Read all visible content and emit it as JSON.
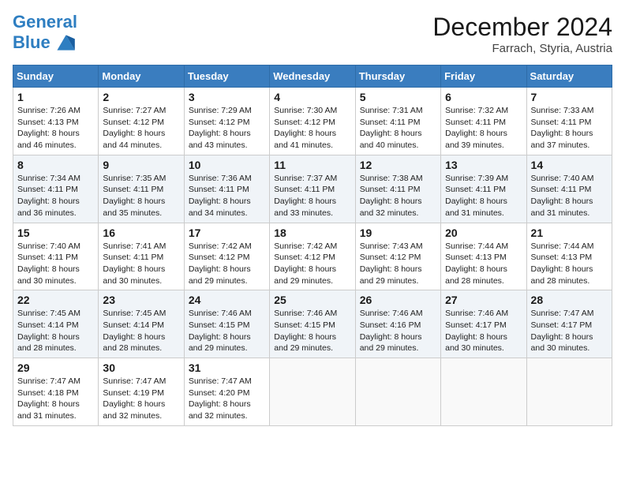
{
  "header": {
    "logo_line1": "General",
    "logo_line2": "Blue",
    "month_title": "December 2024",
    "location": "Farrach, Styria, Austria"
  },
  "columns": [
    "Sunday",
    "Monday",
    "Tuesday",
    "Wednesday",
    "Thursday",
    "Friday",
    "Saturday"
  ],
  "weeks": [
    [
      {
        "day": "1",
        "sunrise": "Sunrise: 7:26 AM",
        "sunset": "Sunset: 4:13 PM",
        "daylight": "Daylight: 8 hours and 46 minutes."
      },
      {
        "day": "2",
        "sunrise": "Sunrise: 7:27 AM",
        "sunset": "Sunset: 4:12 PM",
        "daylight": "Daylight: 8 hours and 44 minutes."
      },
      {
        "day": "3",
        "sunrise": "Sunrise: 7:29 AM",
        "sunset": "Sunset: 4:12 PM",
        "daylight": "Daylight: 8 hours and 43 minutes."
      },
      {
        "day": "4",
        "sunrise": "Sunrise: 7:30 AM",
        "sunset": "Sunset: 4:12 PM",
        "daylight": "Daylight: 8 hours and 41 minutes."
      },
      {
        "day": "5",
        "sunrise": "Sunrise: 7:31 AM",
        "sunset": "Sunset: 4:11 PM",
        "daylight": "Daylight: 8 hours and 40 minutes."
      },
      {
        "day": "6",
        "sunrise": "Sunrise: 7:32 AM",
        "sunset": "Sunset: 4:11 PM",
        "daylight": "Daylight: 8 hours and 39 minutes."
      },
      {
        "day": "7",
        "sunrise": "Sunrise: 7:33 AM",
        "sunset": "Sunset: 4:11 PM",
        "daylight": "Daylight: 8 hours and 37 minutes."
      }
    ],
    [
      {
        "day": "8",
        "sunrise": "Sunrise: 7:34 AM",
        "sunset": "Sunset: 4:11 PM",
        "daylight": "Daylight: 8 hours and 36 minutes."
      },
      {
        "day": "9",
        "sunrise": "Sunrise: 7:35 AM",
        "sunset": "Sunset: 4:11 PM",
        "daylight": "Daylight: 8 hours and 35 minutes."
      },
      {
        "day": "10",
        "sunrise": "Sunrise: 7:36 AM",
        "sunset": "Sunset: 4:11 PM",
        "daylight": "Daylight: 8 hours and 34 minutes."
      },
      {
        "day": "11",
        "sunrise": "Sunrise: 7:37 AM",
        "sunset": "Sunset: 4:11 PM",
        "daylight": "Daylight: 8 hours and 33 minutes."
      },
      {
        "day": "12",
        "sunrise": "Sunrise: 7:38 AM",
        "sunset": "Sunset: 4:11 PM",
        "daylight": "Daylight: 8 hours and 32 minutes."
      },
      {
        "day": "13",
        "sunrise": "Sunrise: 7:39 AM",
        "sunset": "Sunset: 4:11 PM",
        "daylight": "Daylight: 8 hours and 31 minutes."
      },
      {
        "day": "14",
        "sunrise": "Sunrise: 7:40 AM",
        "sunset": "Sunset: 4:11 PM",
        "daylight": "Daylight: 8 hours and 31 minutes."
      }
    ],
    [
      {
        "day": "15",
        "sunrise": "Sunrise: 7:40 AM",
        "sunset": "Sunset: 4:11 PM",
        "daylight": "Daylight: 8 hours and 30 minutes."
      },
      {
        "day": "16",
        "sunrise": "Sunrise: 7:41 AM",
        "sunset": "Sunset: 4:11 PM",
        "daylight": "Daylight: 8 hours and 30 minutes."
      },
      {
        "day": "17",
        "sunrise": "Sunrise: 7:42 AM",
        "sunset": "Sunset: 4:12 PM",
        "daylight": "Daylight: 8 hours and 29 minutes."
      },
      {
        "day": "18",
        "sunrise": "Sunrise: 7:42 AM",
        "sunset": "Sunset: 4:12 PM",
        "daylight": "Daylight: 8 hours and 29 minutes."
      },
      {
        "day": "19",
        "sunrise": "Sunrise: 7:43 AM",
        "sunset": "Sunset: 4:12 PM",
        "daylight": "Daylight: 8 hours and 29 minutes."
      },
      {
        "day": "20",
        "sunrise": "Sunrise: 7:44 AM",
        "sunset": "Sunset: 4:13 PM",
        "daylight": "Daylight: 8 hours and 28 minutes."
      },
      {
        "day": "21",
        "sunrise": "Sunrise: 7:44 AM",
        "sunset": "Sunset: 4:13 PM",
        "daylight": "Daylight: 8 hours and 28 minutes."
      }
    ],
    [
      {
        "day": "22",
        "sunrise": "Sunrise: 7:45 AM",
        "sunset": "Sunset: 4:14 PM",
        "daylight": "Daylight: 8 hours and 28 minutes."
      },
      {
        "day": "23",
        "sunrise": "Sunrise: 7:45 AM",
        "sunset": "Sunset: 4:14 PM",
        "daylight": "Daylight: 8 hours and 28 minutes."
      },
      {
        "day": "24",
        "sunrise": "Sunrise: 7:46 AM",
        "sunset": "Sunset: 4:15 PM",
        "daylight": "Daylight: 8 hours and 29 minutes."
      },
      {
        "day": "25",
        "sunrise": "Sunrise: 7:46 AM",
        "sunset": "Sunset: 4:15 PM",
        "daylight": "Daylight: 8 hours and 29 minutes."
      },
      {
        "day": "26",
        "sunrise": "Sunrise: 7:46 AM",
        "sunset": "Sunset: 4:16 PM",
        "daylight": "Daylight: 8 hours and 29 minutes."
      },
      {
        "day": "27",
        "sunrise": "Sunrise: 7:46 AM",
        "sunset": "Sunset: 4:17 PM",
        "daylight": "Daylight: 8 hours and 30 minutes."
      },
      {
        "day": "28",
        "sunrise": "Sunrise: 7:47 AM",
        "sunset": "Sunset: 4:17 PM",
        "daylight": "Daylight: 8 hours and 30 minutes."
      }
    ],
    [
      {
        "day": "29",
        "sunrise": "Sunrise: 7:47 AM",
        "sunset": "Sunset: 4:18 PM",
        "daylight": "Daylight: 8 hours and 31 minutes."
      },
      {
        "day": "30",
        "sunrise": "Sunrise: 7:47 AM",
        "sunset": "Sunset: 4:19 PM",
        "daylight": "Daylight: 8 hours and 32 minutes."
      },
      {
        "day": "31",
        "sunrise": "Sunrise: 7:47 AM",
        "sunset": "Sunset: 4:20 PM",
        "daylight": "Daylight: 8 hours and 32 minutes."
      },
      null,
      null,
      null,
      null
    ]
  ]
}
